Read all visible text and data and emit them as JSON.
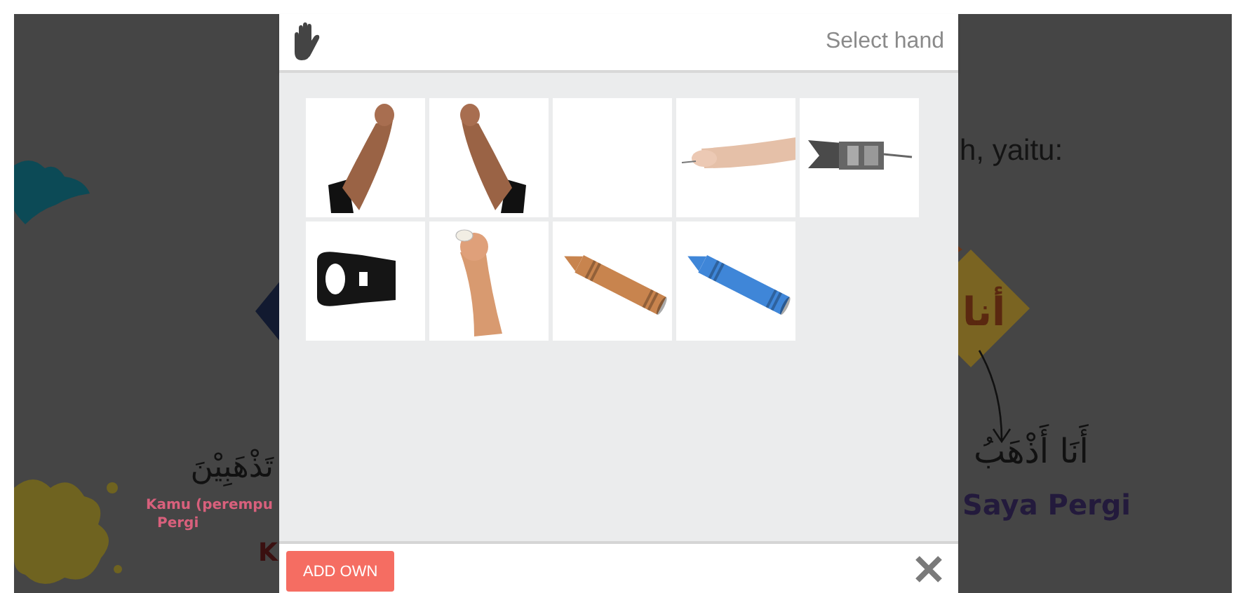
{
  "background": {
    "heading_fragment": "h, yaitu:",
    "pronoun_card": "أنا",
    "sentence_arabic": "أَنَا أَذْهَبُ",
    "sentence_translation": "Saya Pergi",
    "left_arabic": "تَذْهَبِيْنَ",
    "left_translation_line1": "Kamu (perempu",
    "left_translation_line2": "Pergi",
    "left_heading_fragment": "K"
  },
  "dialog": {
    "title": "Select hand",
    "add_button": "ADD OWN",
    "options": [
      {
        "kind": "arm-raised-right"
      },
      {
        "kind": "arm-raised-left"
      },
      {
        "kind": "blank"
      },
      {
        "kind": "arm-horizontal"
      },
      {
        "kind": "zipper-slider"
      },
      {
        "kind": "zipper-pull"
      },
      {
        "kind": "arm-chalk"
      },
      {
        "kind": "crayon",
        "color": "#c8844e"
      },
      {
        "kind": "crayon",
        "color": "#3f86d8"
      }
    ]
  }
}
